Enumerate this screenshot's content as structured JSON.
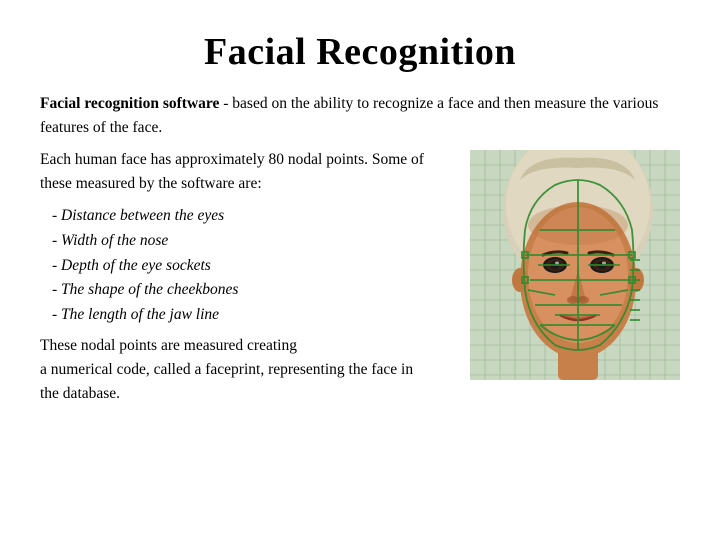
{
  "title": "Facial Recognition",
  "para1_bold": "Facial recognition software",
  "para1_rest": " - based on the ability to recognize a face and then measure the various features of the face.",
  "para2": "Each human face has approximately 80 nodal points. Some of these measured by the software are:",
  "list": [
    "- Distance between the eyes",
    "- Width of the nose",
    "- Depth of the eye sockets",
    "- The shape of the cheekbones",
    "-  The length of the jaw line"
  ],
  "para3_line1": "These nodal points are measured creating",
  "para3_line2": "a numerical code, called a faceprint, representing the face in",
  "para3_line3": "the database.",
  "colors": {
    "background": "#ffffff",
    "text": "#000000",
    "grid": "#b0c4b0",
    "face_outline": "#2d6b2d",
    "face_skin_dark": "#8b5c2a",
    "face_skin_mid": "#c9843c",
    "hair": "#e8e0c8",
    "grid_bg": "#c8d8c0"
  }
}
